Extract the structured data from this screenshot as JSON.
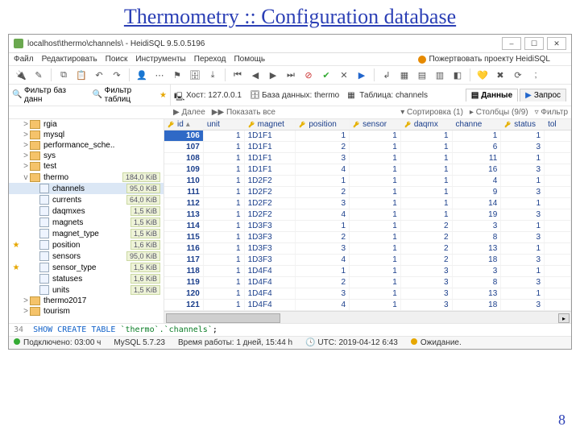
{
  "slide": {
    "title": "Thermometry :: Configuration database",
    "page": "8"
  },
  "window": {
    "title": "localhost\\thermo\\channels\\ - HeidiSQL 9.5.0.5196"
  },
  "menu": [
    "Файл",
    "Редактировать",
    "Поиск",
    "Инструменты",
    "Переход",
    "Помощь"
  ],
  "menu_right": "Пожертвовать проекту HeidiSQL",
  "filters": {
    "none": "Фильтр баз данн",
    "tables": "Фильтр таблиц"
  },
  "crumbs": {
    "host": "Хост: 127.0.0.1",
    "db": "База данных: thermo",
    "table": "Таблица: channels"
  },
  "tabs": {
    "data": "Данные",
    "query": "Запрос"
  },
  "nav": {
    "next": "Далее",
    "all": "Показать все",
    "sort": "Сортировка (1)",
    "cols": "Столбцы (9/9)",
    "filter": "Фильтр"
  },
  "tree": [
    {
      "tw": ">",
      "kind": "db",
      "label": "rgia"
    },
    {
      "tw": ">",
      "kind": "db",
      "label": "mysql"
    },
    {
      "tw": ">",
      "kind": "db",
      "label": "performance_sche.."
    },
    {
      "tw": ">",
      "kind": "db",
      "label": "sys"
    },
    {
      "tw": ">",
      "kind": "db",
      "label": "test"
    },
    {
      "tw": "v",
      "kind": "db",
      "label": "thermo",
      "size": "184,0 KiB"
    },
    {
      "tw": "",
      "kind": "tbl",
      "label": "channels",
      "size": "95,0 KiB",
      "indent": 1,
      "selected": true
    },
    {
      "tw": "",
      "kind": "tbl",
      "label": "currents",
      "size": "64,0 KiB",
      "indent": 1
    },
    {
      "tw": "",
      "kind": "tbl",
      "label": "daqmxes",
      "size": "1,5 KiB",
      "indent": 1
    },
    {
      "tw": "",
      "kind": "tbl",
      "label": "magnets",
      "size": "1,5 KiB",
      "indent": 1
    },
    {
      "tw": "",
      "kind": "tbl",
      "label": "magnet_type",
      "size": "1,5 KiB",
      "indent": 1
    },
    {
      "tw": "",
      "kind": "tbl",
      "label": "position",
      "size": "1,6 KiB",
      "indent": 1,
      "star": true
    },
    {
      "tw": "",
      "kind": "tbl",
      "label": "sensors",
      "size": "95,0 KiB",
      "indent": 1
    },
    {
      "tw": "",
      "kind": "tbl",
      "label": "sensor_type",
      "size": "1,5 KiB",
      "indent": 1,
      "star": true
    },
    {
      "tw": "",
      "kind": "tbl",
      "label": "statuses",
      "size": "1,6 KiB",
      "indent": 1
    },
    {
      "tw": "",
      "kind": "tbl",
      "label": "units",
      "size": "1,5 KiB",
      "indent": 1
    },
    {
      "tw": ">",
      "kind": "db",
      "label": "thermo2017"
    },
    {
      "tw": ">",
      "kind": "db",
      "label": "tourism"
    }
  ],
  "columns": [
    "id",
    "unit",
    "magnet",
    "position",
    "sensor",
    "daqmx",
    "channe",
    "status",
    "tol"
  ],
  "key_cols": [
    0,
    2,
    3,
    4,
    5,
    7
  ],
  "rows": [
    {
      "id": 106,
      "unit": 1,
      "magnet": "1D1F1",
      "position": 1,
      "sensor": 1,
      "daqmx": 1,
      "channe": 1,
      "status": 1,
      "tol": ""
    },
    {
      "id": 107,
      "unit": 1,
      "magnet": "1D1F1",
      "position": 2,
      "sensor": 1,
      "daqmx": 1,
      "channe": 6,
      "status": 3,
      "tol": ""
    },
    {
      "id": 108,
      "unit": 1,
      "magnet": "1D1F1",
      "position": 3,
      "sensor": 1,
      "daqmx": 1,
      "channe": 11,
      "status": 1,
      "tol": ""
    },
    {
      "id": 109,
      "unit": 1,
      "magnet": "1D1F1",
      "position": 4,
      "sensor": 1,
      "daqmx": 1,
      "channe": 16,
      "status": 3,
      "tol": ""
    },
    {
      "id": 110,
      "unit": 1,
      "magnet": "1D2F2",
      "position": 1,
      "sensor": 1,
      "daqmx": 1,
      "channe": 4,
      "status": 1,
      "tol": ""
    },
    {
      "id": 111,
      "unit": 1,
      "magnet": "1D2F2",
      "position": 2,
      "sensor": 1,
      "daqmx": 1,
      "channe": 9,
      "status": 3,
      "tol": ""
    },
    {
      "id": 112,
      "unit": 1,
      "magnet": "1D2F2",
      "position": 3,
      "sensor": 1,
      "daqmx": 1,
      "channe": 14,
      "status": 1,
      "tol": ""
    },
    {
      "id": 113,
      "unit": 1,
      "magnet": "1D2F2",
      "position": 4,
      "sensor": 1,
      "daqmx": 1,
      "channe": 19,
      "status": 3,
      "tol": ""
    },
    {
      "id": 114,
      "unit": 1,
      "magnet": "1D3F3",
      "position": 1,
      "sensor": 1,
      "daqmx": 2,
      "channe": 3,
      "status": 1,
      "tol": ""
    },
    {
      "id": 115,
      "unit": 1,
      "magnet": "1D3F3",
      "position": 2,
      "sensor": 1,
      "daqmx": 2,
      "channe": 8,
      "status": 3,
      "tol": ""
    },
    {
      "id": 116,
      "unit": 1,
      "magnet": "1D3F3",
      "position": 3,
      "sensor": 1,
      "daqmx": 2,
      "channe": 13,
      "status": 1,
      "tol": ""
    },
    {
      "id": 117,
      "unit": 1,
      "magnet": "1D3F3",
      "position": 4,
      "sensor": 1,
      "daqmx": 2,
      "channe": 18,
      "status": 3,
      "tol": ""
    },
    {
      "id": 118,
      "unit": 1,
      "magnet": "1D4F4",
      "position": 1,
      "sensor": 1,
      "daqmx": 3,
      "channe": 3,
      "status": 1,
      "tol": ""
    },
    {
      "id": 119,
      "unit": 1,
      "magnet": "1D4F4",
      "position": 2,
      "sensor": 1,
      "daqmx": 3,
      "channe": 8,
      "status": 3,
      "tol": ""
    },
    {
      "id": 120,
      "unit": 1,
      "magnet": "1D4F4",
      "position": 3,
      "sensor": 1,
      "daqmx": 3,
      "channe": 13,
      "status": 1,
      "tol": ""
    },
    {
      "id": 121,
      "unit": 1,
      "magnet": "1D4F4",
      "position": 4,
      "sensor": 1,
      "daqmx": 3,
      "channe": 18,
      "status": 3,
      "tol": ""
    }
  ],
  "sql": {
    "line": "34",
    "kw": "SHOW CREATE TABLE ",
    "arg": "`thermo`.`channels`"
  },
  "status": {
    "connected": "Подключено: 03:00 ч",
    "server": "MySQL 5.7.23",
    "uptime": "Время работы: 1 дней, 15:44 h",
    "utc": "UTC: 2019-04-12 6:43",
    "idle": "Ожидание."
  }
}
